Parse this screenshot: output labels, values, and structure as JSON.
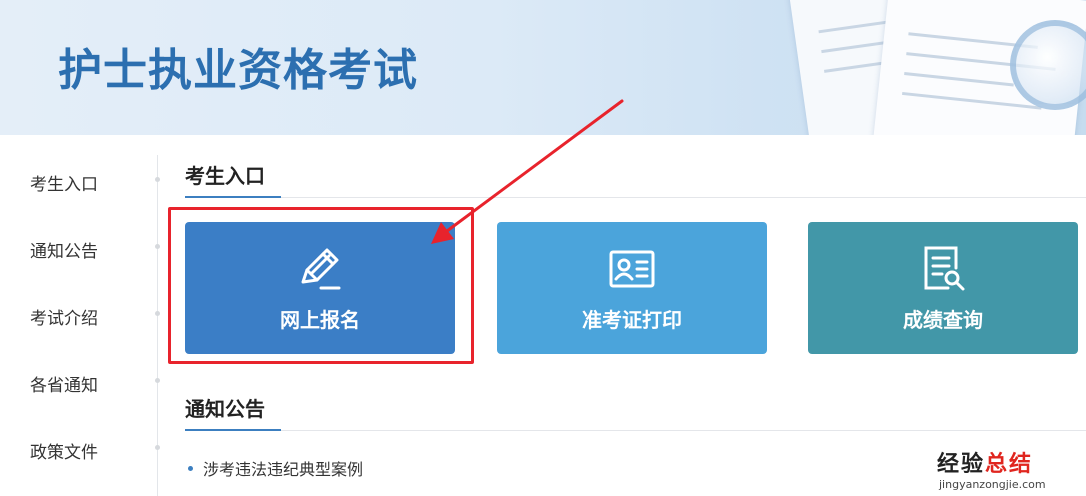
{
  "banner": {
    "title": "护士执业资格考试"
  },
  "sidebar": {
    "items": [
      {
        "label": "考生入口"
      },
      {
        "label": "通知公告"
      },
      {
        "label": "考试介绍"
      },
      {
        "label": "各省通知"
      },
      {
        "label": "政策文件"
      }
    ]
  },
  "candidate_section": {
    "title": "考生入口",
    "cards": [
      {
        "label": "网上报名",
        "icon": "pencil-icon",
        "color": "#3b7ec6"
      },
      {
        "label": "准考证打印",
        "icon": "id-card-icon",
        "color": "#4ba4db"
      },
      {
        "label": "成绩查询",
        "icon": "document-search-icon",
        "color": "#4297a8"
      }
    ]
  },
  "notice_section": {
    "title": "通知公告",
    "items": [
      {
        "label": "涉考违法违纪典型案例"
      }
    ]
  },
  "annotation": {
    "color": "#e8232c"
  },
  "watermark": {
    "brand_a": "经验",
    "brand_b": "总结",
    "url": "jingyanzongjie.com"
  }
}
